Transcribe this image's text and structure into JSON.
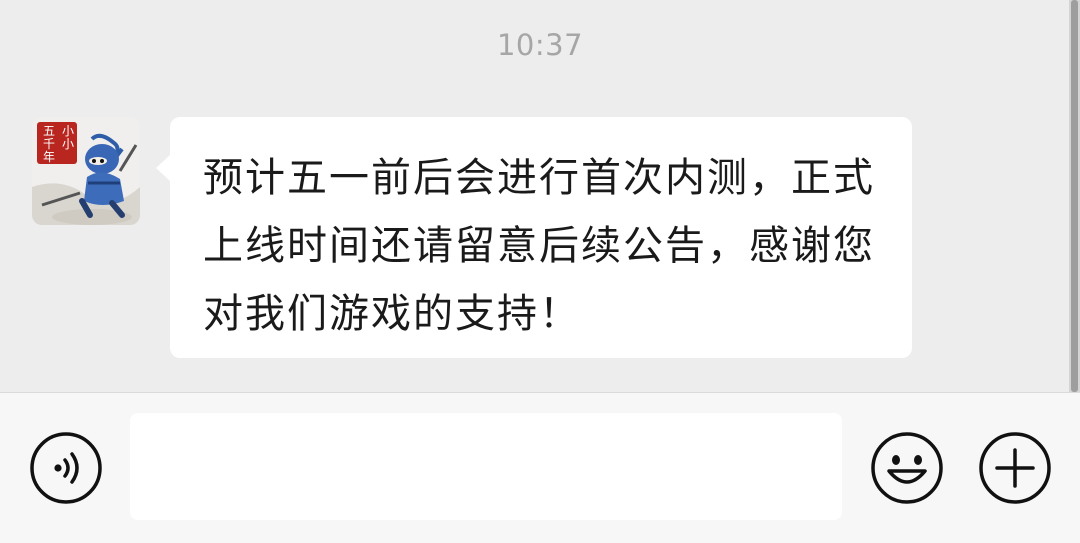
{
  "chat": {
    "timestamp": "10:37",
    "messages": [
      {
        "sender": "avatar",
        "avatar_text": "小小五千年",
        "text": "预计五一前后会进行首次内测，正式上线时间还请留意后续公告，感谢您对我们游戏的支持！"
      }
    ]
  },
  "input_bar": {
    "voice_icon": "voice-icon",
    "input_value": "",
    "emoji_icon": "emoji-icon",
    "add_icon": "plus-icon"
  },
  "colors": {
    "background": "#ededed",
    "bubble": "#ffffff",
    "text": "#1a1a1a",
    "timestamp": "#a6a6a6",
    "icon": "#111111"
  }
}
